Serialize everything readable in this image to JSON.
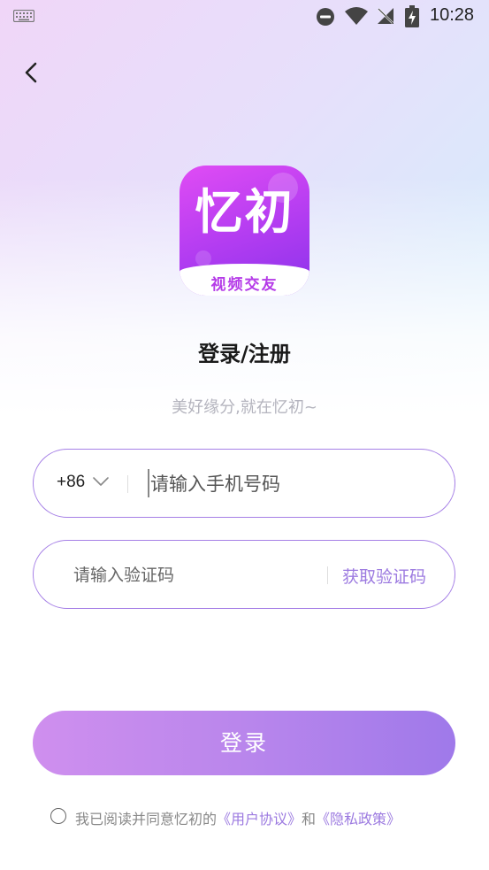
{
  "status_bar": {
    "time": "10:28",
    "icons": [
      "keyboard-icon",
      "do-not-disturb-icon",
      "wifi-icon",
      "no-sim-icon",
      "battery-charging-icon"
    ]
  },
  "nav": {
    "back_icon": "chevron-left-icon"
  },
  "logo": {
    "main_text": "忆初",
    "sub_text": "视频交友"
  },
  "header": {
    "title": "登录/注册",
    "subtitle": "美好缘分,就在忆初~"
  },
  "phone": {
    "country_code": "+86",
    "country_chevron": "chevron-down-icon",
    "placeholder": "请输入手机号码"
  },
  "code": {
    "placeholder": "请输入验证码",
    "get_code_label": "获取验证码"
  },
  "login_button": {
    "label": "登录"
  },
  "agreement": {
    "prefix": "我已阅读并同意忆初的",
    "user_agreement": "《用户协议》",
    "conjunction": "和",
    "privacy_policy": "《隐私政策》"
  },
  "colors": {
    "accent": "#9c7ae0",
    "field_border": "#a680e6",
    "button_start": "#cf8fee",
    "button_end": "#9f79ea",
    "logo_start": "#e04cf4",
    "logo_end": "#8a33ea"
  }
}
